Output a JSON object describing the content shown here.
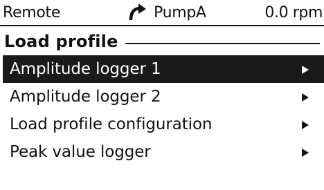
{
  "status": {
    "mode": "Remote",
    "direction_icon": "rotate-clockwise-icon",
    "drive_name": "PumpA",
    "speed": "0.0 rpm"
  },
  "menu": {
    "title": "Load profile",
    "items": [
      {
        "label": "Amplitude logger 1",
        "selected": true
      },
      {
        "label": "Amplitude logger 2",
        "selected": false
      },
      {
        "label": "Load profile configuration",
        "selected": false
      },
      {
        "label": "Peak value logger",
        "selected": false
      }
    ]
  },
  "colors": {
    "selection_background": "#1a1a1a",
    "foreground": "#111111",
    "background": "#ffffff"
  }
}
